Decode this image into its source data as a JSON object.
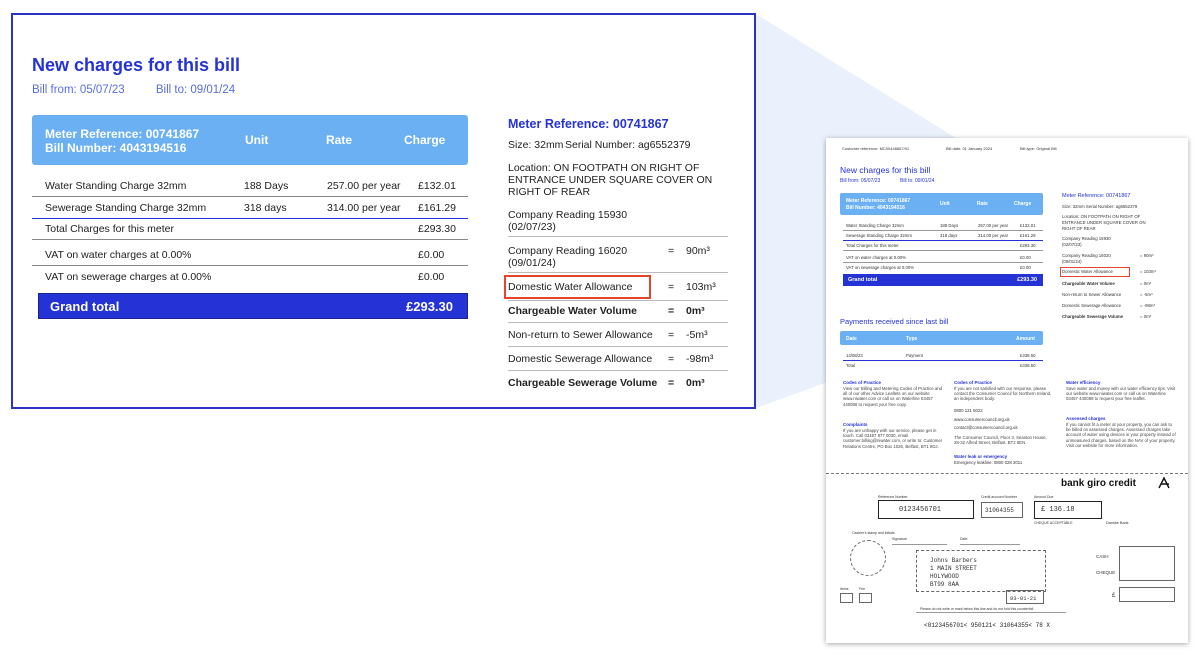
{
  "callout": {
    "heading": "New charges for this bill",
    "bill_from": "Bill from: 05/07/23",
    "bill_to": "Bill to: 09/01/24",
    "table_header": {
      "meter_ref": "Meter Reference: 00741867",
      "bill_number": "Bill Number: 4043194516",
      "unit": "Unit",
      "rate": "Rate",
      "charge": "Charge"
    },
    "rows": [
      {
        "label": "Water Standing Charge 32mm",
        "unit": "188 Days",
        "rate": "257.00 per year",
        "charge": "£132.01"
      },
      {
        "label": "Sewerage Standing Charge 32mm",
        "unit": "318 days",
        "rate": "314.00 per year",
        "charge": "£161.29"
      }
    ],
    "total": {
      "label": "Total Charges for this meter",
      "value": "£293.30"
    },
    "vat": [
      {
        "label": "VAT on water charges at 0.00%",
        "value": "£0.00"
      },
      {
        "label": "VAT on sewerage charges at 0.00%",
        "value": "£0.00"
      }
    ],
    "grand_total": {
      "label": "Grand total",
      "value": "£293.30"
    },
    "meter": {
      "title": "Meter Reference: 00741867",
      "size": "Size: 32mm",
      "serial": "Serial Number: ag6552379",
      "location_1": "Location: ON FOOTPATH ON RIGHT OF",
      "location_2": "ENTRANCE UNDER SQUARE COVER ON",
      "location_3": "RIGHT OF REAR",
      "reading1_label": "Company Reading 15930",
      "reading1_date": "(02/07/23)",
      "reading2_label": "Company Reading 16020",
      "reading2_date": "(09/01/24)",
      "reading2_value": "90m³",
      "items": [
        {
          "label": "Domestic Water Allowance",
          "value": "103m³"
        },
        {
          "label": "Chargeable Water Volume",
          "value": "0m³"
        },
        {
          "label": "Non-return to Sewer Allowance",
          "value": "-5m³"
        },
        {
          "label": "Domestic Sewerage Allowance",
          "value": "-98m³"
        },
        {
          "label": "Chargeable Sewerage Volume",
          "value": "0m³"
        }
      ],
      "equals": "="
    }
  },
  "mini": {
    "customer_ref": "Customer reference: MC00446867/01",
    "bill_date": "Bill date: 01 January 2024",
    "bill_type": "Bill type: Original Bill",
    "heading": "New charges for this bill",
    "bill_from": "Bill from: 05/07/23",
    "bill_to": "Bill to: 09/01/24",
    "meter_ref": "Meter Reference: 00741867",
    "bill_number": "Bill Number: 4043194516",
    "unit": "Unit",
    "rate": "Rate",
    "charge": "Charge",
    "rows": [
      {
        "label": "Water Standing Charge 32mm",
        "unit": "188 Days",
        "rate": "257.00 per year",
        "charge": "£132.01"
      },
      {
        "label": "Sewerage Standing Charge 32mm",
        "unit": "318 days",
        "rate": "314.00 per year",
        "charge": "£161.29"
      },
      {
        "label": "Total Charges for this meter",
        "unit": "",
        "rate": "",
        "charge": "£293.30"
      },
      {
        "label": "VAT on water charges at 0.00%",
        "unit": "",
        "rate": "",
        "charge": "£0.00"
      },
      {
        "label": "VAT on sewerage charges at 0.00%",
        "unit": "",
        "rate": "",
        "charge": "£0.00"
      }
    ],
    "grand_total": "Grand total",
    "grand_value": "£293.30",
    "meter_title": "Meter Reference: 00741867",
    "size_serial": "Size: 32mm    Serial Number: ag6552379",
    "loc1": "Location: ON FOOTPATH ON RIGHT OF",
    "loc2": "ENTRANCE UNDER SQUARE COVER ON",
    "loc3": "RIGHT OF REAR",
    "r1a": "Company Reading 15930",
    "r1b": "(02/07/23)",
    "r2a": "Company Reading 16020",
    "r2b": "(09/01/24)",
    "r2v": "=    90m³",
    "m_items": [
      {
        "label": "Domestic Water Allowance",
        "value": "=    103m³"
      },
      {
        "label": "Chargeable Water Volume",
        "value": "=    0m³"
      },
      {
        "label": "Non-return to Sewer Allowance",
        "value": "=    -5m³"
      },
      {
        "label": "Domestic Sewerage Allowance",
        "value": "=    -98m³"
      },
      {
        "label": "Chargeable Sewerage Volume",
        "value": "=    0m³"
      }
    ],
    "payments_heading": "Payments received since last bill",
    "pay_date": "Date",
    "pay_type": "Type",
    "pay_amount": "Amount",
    "pay_row": {
      "date": "14/08/23",
      "type": "Payment",
      "amount": "£338.50"
    },
    "pay_total": {
      "label": "Total",
      "amount": "£338.50"
    },
    "col1_title": "Codes of Practice",
    "col1_text": "View our Billing and Metering Codes of Practice and all of our other Advice Leaflets on our website www.niwater.com or call us on Waterline 03457 440088 to request your free copy.",
    "col1_title2": "Complaints",
    "col1_text2": "If you are unhappy with our service, please get in touch. Call 03457 877 0030, email customer.billing@niwater.com, or write to: Customer Relations Centre, PO Box 1026, Belfast, BT1 9DJ.",
    "col2_title": "Codes of Practice",
    "col2_text": "If you are not satisfied with our response, please contact the Consumer Council for Northern Ireland, an independent body.",
    "col2_phone": "0800 121 6022",
    "col2_web": "www.consumercouncil.org.uk",
    "col2_email": "contact@consumercouncil.org.uk",
    "col2_addr": "The Consumer Council, Floor 3, Seaston House, 28-32 Alfred Street, Belfast, BT2 8EN",
    "col2_title2": "Water leak or emergency",
    "col2_text2": "Emergency leakline: 0800 028 2011",
    "col3_title": "Water efficiency",
    "col3_text": "Save water and money with our water efficiency tips. Visit our website www.niwater.com or call us on Waterline 03457 440088 to request your free leaflet.",
    "col3_title2": "Assessed charges",
    "col3_text2": "If you cannot fit a meter at your property, you can ask to be billed on assessed charges. Assessed charges take account of water using devices in your property instead of unmeasured charges, based on the NAV of your property. Visit our website for more information.",
    "giro_title": "bank giro credit",
    "ref_label": "Reference Number",
    "ref_number": "0123456701",
    "credit_label": "Credit account Number",
    "credit_number": "31064355",
    "amount_label": "Amount Due",
    "amount_value": "£  136.18",
    "cheques": "CHEQUE ACCEPTABLE",
    "cashier_label": "Cashier's stamp and initials",
    "signature": "Signature",
    "date_label": "Date",
    "customer_name": "Johns Barbers",
    "addr1": "1 MAIN STREET",
    "addr2": "HOLYWOOD",
    "addr3": "BT99 8AA",
    "sort_code": "93-01-21",
    "cash": "CASH",
    "cheque": "CHEQUE",
    "pound": "£",
    "bank_name": "Danske Bank",
    "items_label": "Items",
    "fee_label": "Fee",
    "footer_note": "Please do not write or mark below this line and do not fold this counterfoil",
    "micr": "<0123456701<  950121<  31064355<  78  X"
  }
}
